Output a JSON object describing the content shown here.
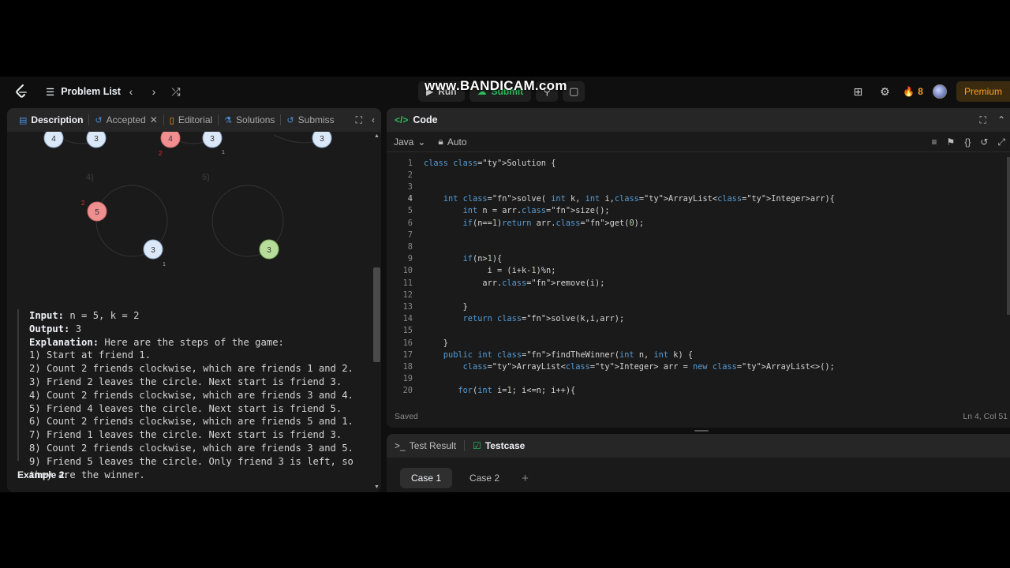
{
  "watermark": "www.BANDICAM.com",
  "nav": {
    "problem_list": "Problem List",
    "run_label": "Run",
    "submit_label": "Submit",
    "streak_count": "8",
    "premium_label": "Premium"
  },
  "left_tabs": {
    "description": "Description",
    "accepted": "Accepted",
    "editorial": "Editorial",
    "solutions": "Solutions",
    "submissions": "Submiss"
  },
  "diagram": {
    "top_row_nodes": [
      "4",
      "3",
      "4",
      "3",
      "3"
    ],
    "step4_label": "4)",
    "step5_label": "5)",
    "step4_nodes": [
      "5",
      "3"
    ],
    "step5_nodes": [
      "3"
    ],
    "marks": [
      "2",
      "1",
      "2",
      "1"
    ]
  },
  "example1": {
    "input_label": "Input:",
    "input_value": "n = 5, k = 2",
    "output_label": "Output:",
    "output_value": "3",
    "explanation_label": "Explanation:",
    "explanation_value": "Here are the steps of the game:",
    "steps": [
      "1) Start at friend 1.",
      "2) Count 2 friends clockwise, which are friends 1 and 2.",
      "3) Friend 2 leaves the circle. Next start is friend 3.",
      "4) Count 2 friends clockwise, which are friends 3 and 4.",
      "5) Friend 4 leaves the circle. Next start is friend 5.",
      "6) Count 2 friends clockwise, which are friends 5 and 1.",
      "7) Friend 1 leaves the circle. Next start is friend 3.",
      "8) Count 2 friends clockwise, which are friends 3 and 5.",
      "9) Friend 5 leaves the circle. Only friend 3 is left, so",
      "they are the winner."
    ]
  },
  "example2_heading": "Example 2:",
  "code_panel": {
    "title": "Code",
    "language": "Java",
    "mode": "Auto",
    "status_saved": "Saved",
    "cursor_pos": "Ln 4, Col 51",
    "line_numbers": [
      "1",
      "2",
      "3",
      "4",
      "5",
      "6",
      "7",
      "8",
      "9",
      "10",
      "11",
      "12",
      "13",
      "14",
      "15",
      "16",
      "17",
      "18",
      "19",
      "20"
    ],
    "current_line": 4,
    "lines": [
      "class Solution {",
      "",
      "",
      "    int solve( int k, int i,ArrayList<Integer>arr){",
      "        int n = arr.size();",
      "        if(n==1)return arr.get(0);",
      "",
      "",
      "        if(n>1){",
      "             i = (i+k-1)%n;",
      "            arr.remove(i);",
      "",
      "        }",
      "        return solve(k,i,arr);",
      "",
      "    }",
      "    public int findTheWinner(int n, int k) {",
      "        ArrayList<Integer> arr = new ArrayList<>();",
      "",
      "       for(int i=1; i<=n; i++){"
    ]
  },
  "test_panel": {
    "test_result": "Test Result",
    "testcase": "Testcase",
    "cases": [
      "Case 1",
      "Case 2"
    ],
    "add": "+"
  },
  "colors": {
    "accent_green": "#2cbb5d",
    "accent_orange": "#ffa116",
    "node_blue": "#dbe8f7",
    "node_red": "#f08f8f",
    "node_green": "#b6dd9a"
  }
}
